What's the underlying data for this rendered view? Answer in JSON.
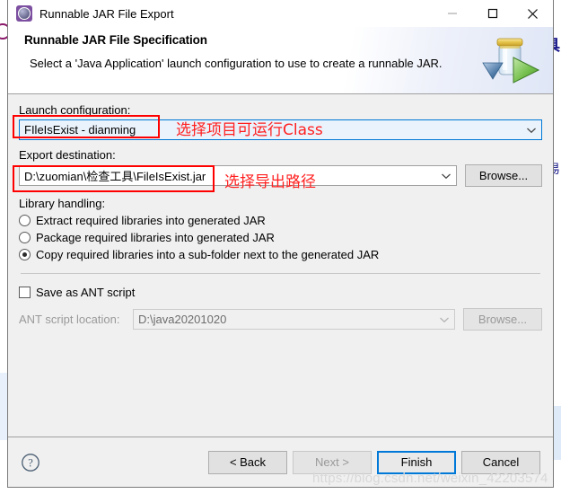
{
  "window": {
    "title": "Runnable JAR File Export",
    "icon": "jar-export-icon",
    "minimize_label": "—",
    "maximize_label": "□",
    "close_label": "✕"
  },
  "header": {
    "title": "Runnable JAR File Specification",
    "description": "Select a 'Java Application' launch configuration to use to create a runnable JAR.",
    "banner_icon": "jar-with-play-arrow-icon"
  },
  "form": {
    "launch_configuration": {
      "label": "Launch configuration:",
      "value": "FIleIsExist - dianming",
      "focused": true
    },
    "export_destination": {
      "label": "Export destination:",
      "value": "D:\\zuomian\\检查工具\\FileIsExist.jar",
      "browse_label": "Browse..."
    },
    "library_handling": {
      "label": "Library handling:",
      "options": [
        {
          "label": "Extract required libraries into generated JAR",
          "selected": false
        },
        {
          "label": "Package required libraries into generated JAR",
          "selected": false
        },
        {
          "label": "Copy required libraries into a sub-folder next to the generated JAR",
          "selected": true
        }
      ]
    },
    "ant": {
      "save_label": "Save as ANT script",
      "checked": false,
      "location_label": "ANT script location:",
      "location_value": "D:\\java20201020",
      "browse_label": "Browse...",
      "enabled": false
    }
  },
  "footer": {
    "help_icon": "help-question-icon",
    "back_label": "< Back",
    "next_label": "Next >",
    "finish_label": "Finish",
    "cancel_label": "Cancel",
    "next_enabled": false,
    "finish_is_default": true
  },
  "annotations": [
    {
      "text": "选择项目可运行Class",
      "color": "#ff2020"
    },
    {
      "text": "选择导出路径",
      "color": "#ff2020"
    }
  ],
  "watermark": {
    "text": "https://blog.csdn.net/weixin_42203574"
  },
  "background": {
    "glyph_right": "具",
    "glyph_right2": "易"
  },
  "colors": {
    "accent": "#0078d7",
    "annotation": "#ff0000",
    "dialog_bg": "#f0f0f0",
    "header_bg": "#ffffff"
  }
}
